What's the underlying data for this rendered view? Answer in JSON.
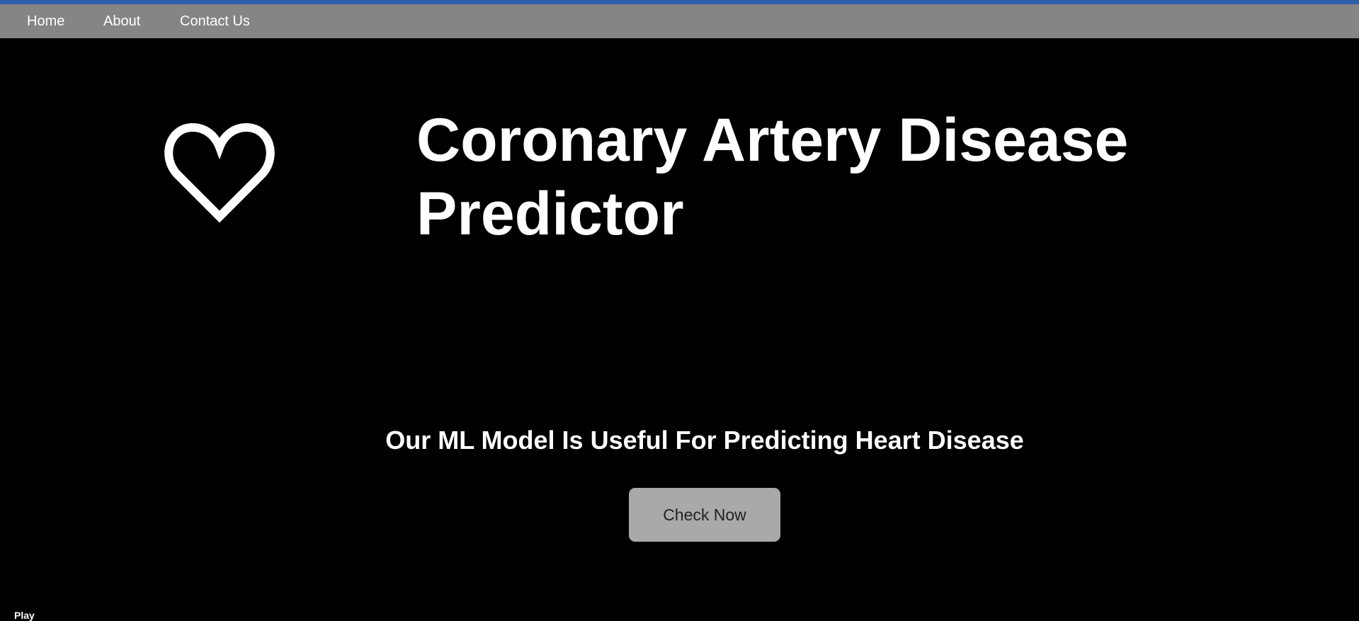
{
  "colors": {
    "accent_strip": "#2f5ea8",
    "navbar_background": "#858585",
    "page_background": "#000000",
    "text": "#ffffff",
    "button_background": "#a9a9a9",
    "button_text": "#222222"
  },
  "nav": {
    "items": [
      {
        "label": "Home"
      },
      {
        "label": "About"
      },
      {
        "label": "Contact Us"
      }
    ]
  },
  "hero": {
    "icon": "heart-outline-icon",
    "title": "Coronary Artery Disease Predictor",
    "subtitle": "Our ML Model Is Useful For Predicting Heart Disease",
    "cta_label": "Check Now"
  },
  "media": {
    "play_label": "Play"
  }
}
